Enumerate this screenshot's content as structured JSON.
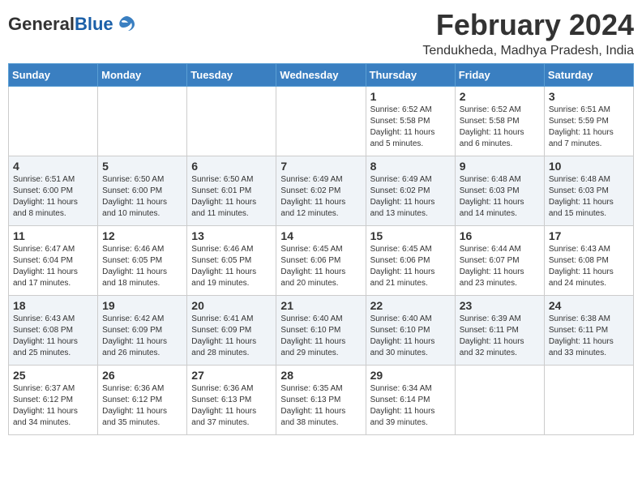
{
  "header": {
    "logo_general": "General",
    "logo_blue": "Blue",
    "title": "February 2024",
    "subtitle": "Tendukheda, Madhya Pradesh, India"
  },
  "weekdays": [
    "Sunday",
    "Monday",
    "Tuesday",
    "Wednesday",
    "Thursday",
    "Friday",
    "Saturday"
  ],
  "weeks": [
    [
      {
        "day": "",
        "info": ""
      },
      {
        "day": "",
        "info": ""
      },
      {
        "day": "",
        "info": ""
      },
      {
        "day": "",
        "info": ""
      },
      {
        "day": "1",
        "info": "Sunrise: 6:52 AM\nSunset: 5:58 PM\nDaylight: 11 hours and 5 minutes."
      },
      {
        "day": "2",
        "info": "Sunrise: 6:52 AM\nSunset: 5:58 PM\nDaylight: 11 hours and 6 minutes."
      },
      {
        "day": "3",
        "info": "Sunrise: 6:51 AM\nSunset: 5:59 PM\nDaylight: 11 hours and 7 minutes."
      }
    ],
    [
      {
        "day": "4",
        "info": "Sunrise: 6:51 AM\nSunset: 6:00 PM\nDaylight: 11 hours and 8 minutes."
      },
      {
        "day": "5",
        "info": "Sunrise: 6:50 AM\nSunset: 6:00 PM\nDaylight: 11 hours and 10 minutes."
      },
      {
        "day": "6",
        "info": "Sunrise: 6:50 AM\nSunset: 6:01 PM\nDaylight: 11 hours and 11 minutes."
      },
      {
        "day": "7",
        "info": "Sunrise: 6:49 AM\nSunset: 6:02 PM\nDaylight: 11 hours and 12 minutes."
      },
      {
        "day": "8",
        "info": "Sunrise: 6:49 AM\nSunset: 6:02 PM\nDaylight: 11 hours and 13 minutes."
      },
      {
        "day": "9",
        "info": "Sunrise: 6:48 AM\nSunset: 6:03 PM\nDaylight: 11 hours and 14 minutes."
      },
      {
        "day": "10",
        "info": "Sunrise: 6:48 AM\nSunset: 6:03 PM\nDaylight: 11 hours and 15 minutes."
      }
    ],
    [
      {
        "day": "11",
        "info": "Sunrise: 6:47 AM\nSunset: 6:04 PM\nDaylight: 11 hours and 17 minutes."
      },
      {
        "day": "12",
        "info": "Sunrise: 6:46 AM\nSunset: 6:05 PM\nDaylight: 11 hours and 18 minutes."
      },
      {
        "day": "13",
        "info": "Sunrise: 6:46 AM\nSunset: 6:05 PM\nDaylight: 11 hours and 19 minutes."
      },
      {
        "day": "14",
        "info": "Sunrise: 6:45 AM\nSunset: 6:06 PM\nDaylight: 11 hours and 20 minutes."
      },
      {
        "day": "15",
        "info": "Sunrise: 6:45 AM\nSunset: 6:06 PM\nDaylight: 11 hours and 21 minutes."
      },
      {
        "day": "16",
        "info": "Sunrise: 6:44 AM\nSunset: 6:07 PM\nDaylight: 11 hours and 23 minutes."
      },
      {
        "day": "17",
        "info": "Sunrise: 6:43 AM\nSunset: 6:08 PM\nDaylight: 11 hours and 24 minutes."
      }
    ],
    [
      {
        "day": "18",
        "info": "Sunrise: 6:43 AM\nSunset: 6:08 PM\nDaylight: 11 hours and 25 minutes."
      },
      {
        "day": "19",
        "info": "Sunrise: 6:42 AM\nSunset: 6:09 PM\nDaylight: 11 hours and 26 minutes."
      },
      {
        "day": "20",
        "info": "Sunrise: 6:41 AM\nSunset: 6:09 PM\nDaylight: 11 hours and 28 minutes."
      },
      {
        "day": "21",
        "info": "Sunrise: 6:40 AM\nSunset: 6:10 PM\nDaylight: 11 hours and 29 minutes."
      },
      {
        "day": "22",
        "info": "Sunrise: 6:40 AM\nSunset: 6:10 PM\nDaylight: 11 hours and 30 minutes."
      },
      {
        "day": "23",
        "info": "Sunrise: 6:39 AM\nSunset: 6:11 PM\nDaylight: 11 hours and 32 minutes."
      },
      {
        "day": "24",
        "info": "Sunrise: 6:38 AM\nSunset: 6:11 PM\nDaylight: 11 hours and 33 minutes."
      }
    ],
    [
      {
        "day": "25",
        "info": "Sunrise: 6:37 AM\nSunset: 6:12 PM\nDaylight: 11 hours and 34 minutes."
      },
      {
        "day": "26",
        "info": "Sunrise: 6:36 AM\nSunset: 6:12 PM\nDaylight: 11 hours and 35 minutes."
      },
      {
        "day": "27",
        "info": "Sunrise: 6:36 AM\nSunset: 6:13 PM\nDaylight: 11 hours and 37 minutes."
      },
      {
        "day": "28",
        "info": "Sunrise: 6:35 AM\nSunset: 6:13 PM\nDaylight: 11 hours and 38 minutes."
      },
      {
        "day": "29",
        "info": "Sunrise: 6:34 AM\nSunset: 6:14 PM\nDaylight: 11 hours and 39 minutes."
      },
      {
        "day": "",
        "info": ""
      },
      {
        "day": "",
        "info": ""
      }
    ]
  ]
}
